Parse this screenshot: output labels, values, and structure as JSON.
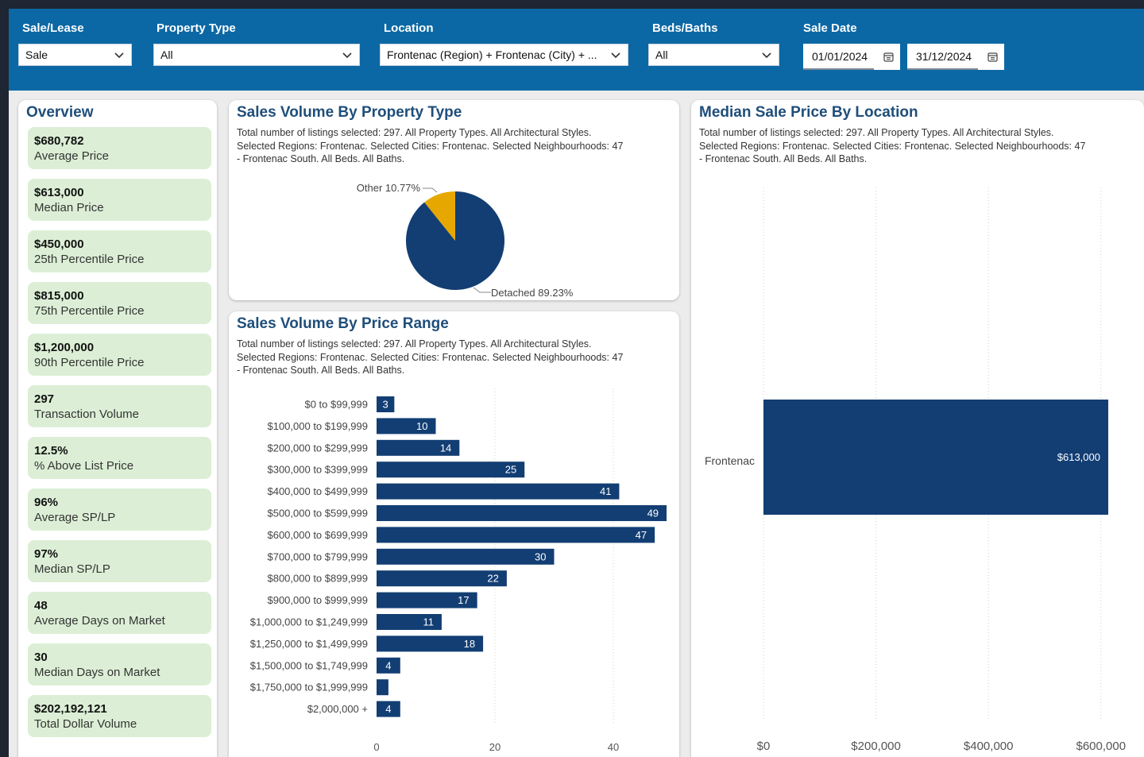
{
  "filters": {
    "sale_lease": {
      "label": "Sale/Lease",
      "value": "Sale"
    },
    "property_type": {
      "label": "Property Type",
      "value": "All"
    },
    "location": {
      "label": "Location",
      "value": "Frontenac (Region) + Frontenac (City) + ..."
    },
    "beds_baths": {
      "label": "Beds/Baths",
      "value": "All"
    },
    "sale_date": {
      "label": "Sale Date",
      "start": "01/01/2024",
      "end": "31/12/2024"
    }
  },
  "overview": {
    "title": "Overview",
    "kpis": [
      {
        "value": "$680,782",
        "label": "Average Price"
      },
      {
        "value": "$613,000",
        "label": "Median Price"
      },
      {
        "value": "$450,000",
        "label": "25th Percentile Price"
      },
      {
        "value": "$815,000",
        "label": "75th Percentile Price"
      },
      {
        "value": "$1,200,000",
        "label": "90th Percentile Price"
      },
      {
        "value": "297",
        "label": "Transaction Volume"
      },
      {
        "value": "12.5%",
        "label": "% Above List Price"
      },
      {
        "value": "96%",
        "label": "Average SP/LP"
      },
      {
        "value": "97%",
        "label": "Median SP/LP"
      },
      {
        "value": "48",
        "label": "Average Days on Market"
      },
      {
        "value": "30",
        "label": "Median Days on Market"
      },
      {
        "value": "$202,192,121",
        "label": "Total Dollar Volume"
      }
    ]
  },
  "pie_card": {
    "title": "Sales Volume By Property Type",
    "subtitle_lines": [
      "Total number of listings selected: 297. All Property Types. All Architectural Styles.",
      "Selected Regions: Frontenac. Selected Cities: Frontenac. Selected Neighbourhoods: 47",
      "- Frontenac South. All Beds. All Baths."
    ]
  },
  "price_card": {
    "title": "Sales Volume By Price Range",
    "subtitle_lines": [
      "Total number of listings selected: 297. All Property Types. All Architectural Styles.",
      "Selected Regions: Frontenac. Selected Cities: Frontenac. Selected Neighbourhoods: 47",
      "- Frontenac South. All Beds. All Baths."
    ]
  },
  "location_card": {
    "title": "Median Sale Price By Location",
    "subtitle_lines": [
      "Total number of listings selected: 297. All Property Types. All Architectural Styles.",
      "Selected Regions: Frontenac. Selected Cities: Frontenac. Selected Neighbourhoods: 47",
      "- Frontenac South. All Beds. All Baths."
    ]
  },
  "colors": {
    "navy": "#123e73",
    "gold": "#e6a800",
    "header": "#0c68a4",
    "kpi_bg": "#dcefd6"
  },
  "chart_data": [
    {
      "type": "pie",
      "labels": [
        "Detached",
        "Other"
      ],
      "values": [
        89.23,
        10.77
      ],
      "data_labels": [
        "Detached 89.23%",
        "Other 10.77%"
      ],
      "colors": [
        "#123e73",
        "#e6a800"
      ]
    },
    {
      "type": "bar",
      "orientation": "horizontal",
      "categories": [
        "$0 to $99,999",
        "$100,000 to $199,999",
        "$200,000 to $299,999",
        "$300,000 to $399,999",
        "$400,000 to $499,999",
        "$500,000 to $599,999",
        "$600,000 to $699,999",
        "$700,000 to $799,999",
        "$800,000 to $899,999",
        "$900,000 to $999,999",
        "$1,000,000 to $1,249,999",
        "$1,250,000 to $1,499,999",
        "$1,500,000 to $1,749,999",
        "$1,750,000 to $1,999,999",
        "$2,000,000 +"
      ],
      "values": [
        3,
        10,
        14,
        25,
        41,
        49,
        47,
        30,
        22,
        17,
        11,
        18,
        4,
        2,
        4
      ],
      "data_labels": [
        "3",
        "10",
        "14",
        "25",
        "41",
        "49",
        "47",
        "30",
        "22",
        "17",
        "11",
        "18",
        "4",
        "",
        "4"
      ],
      "xlim": [
        0,
        50
      ],
      "xticks": [
        0,
        20,
        40
      ],
      "xtick_labels": [
        "0",
        "20",
        "40"
      ],
      "grid": true
    },
    {
      "type": "bar",
      "orientation": "horizontal",
      "categories": [
        "Frontenac"
      ],
      "values": [
        613000
      ],
      "data_labels": [
        "$613,000"
      ],
      "xlim": [
        0,
        630000
      ],
      "xticks": [
        0,
        200000,
        400000,
        600000
      ],
      "xtick_labels": [
        "$0",
        "$200,000",
        "$400,000",
        "$600,000"
      ],
      "grid": true
    }
  ]
}
